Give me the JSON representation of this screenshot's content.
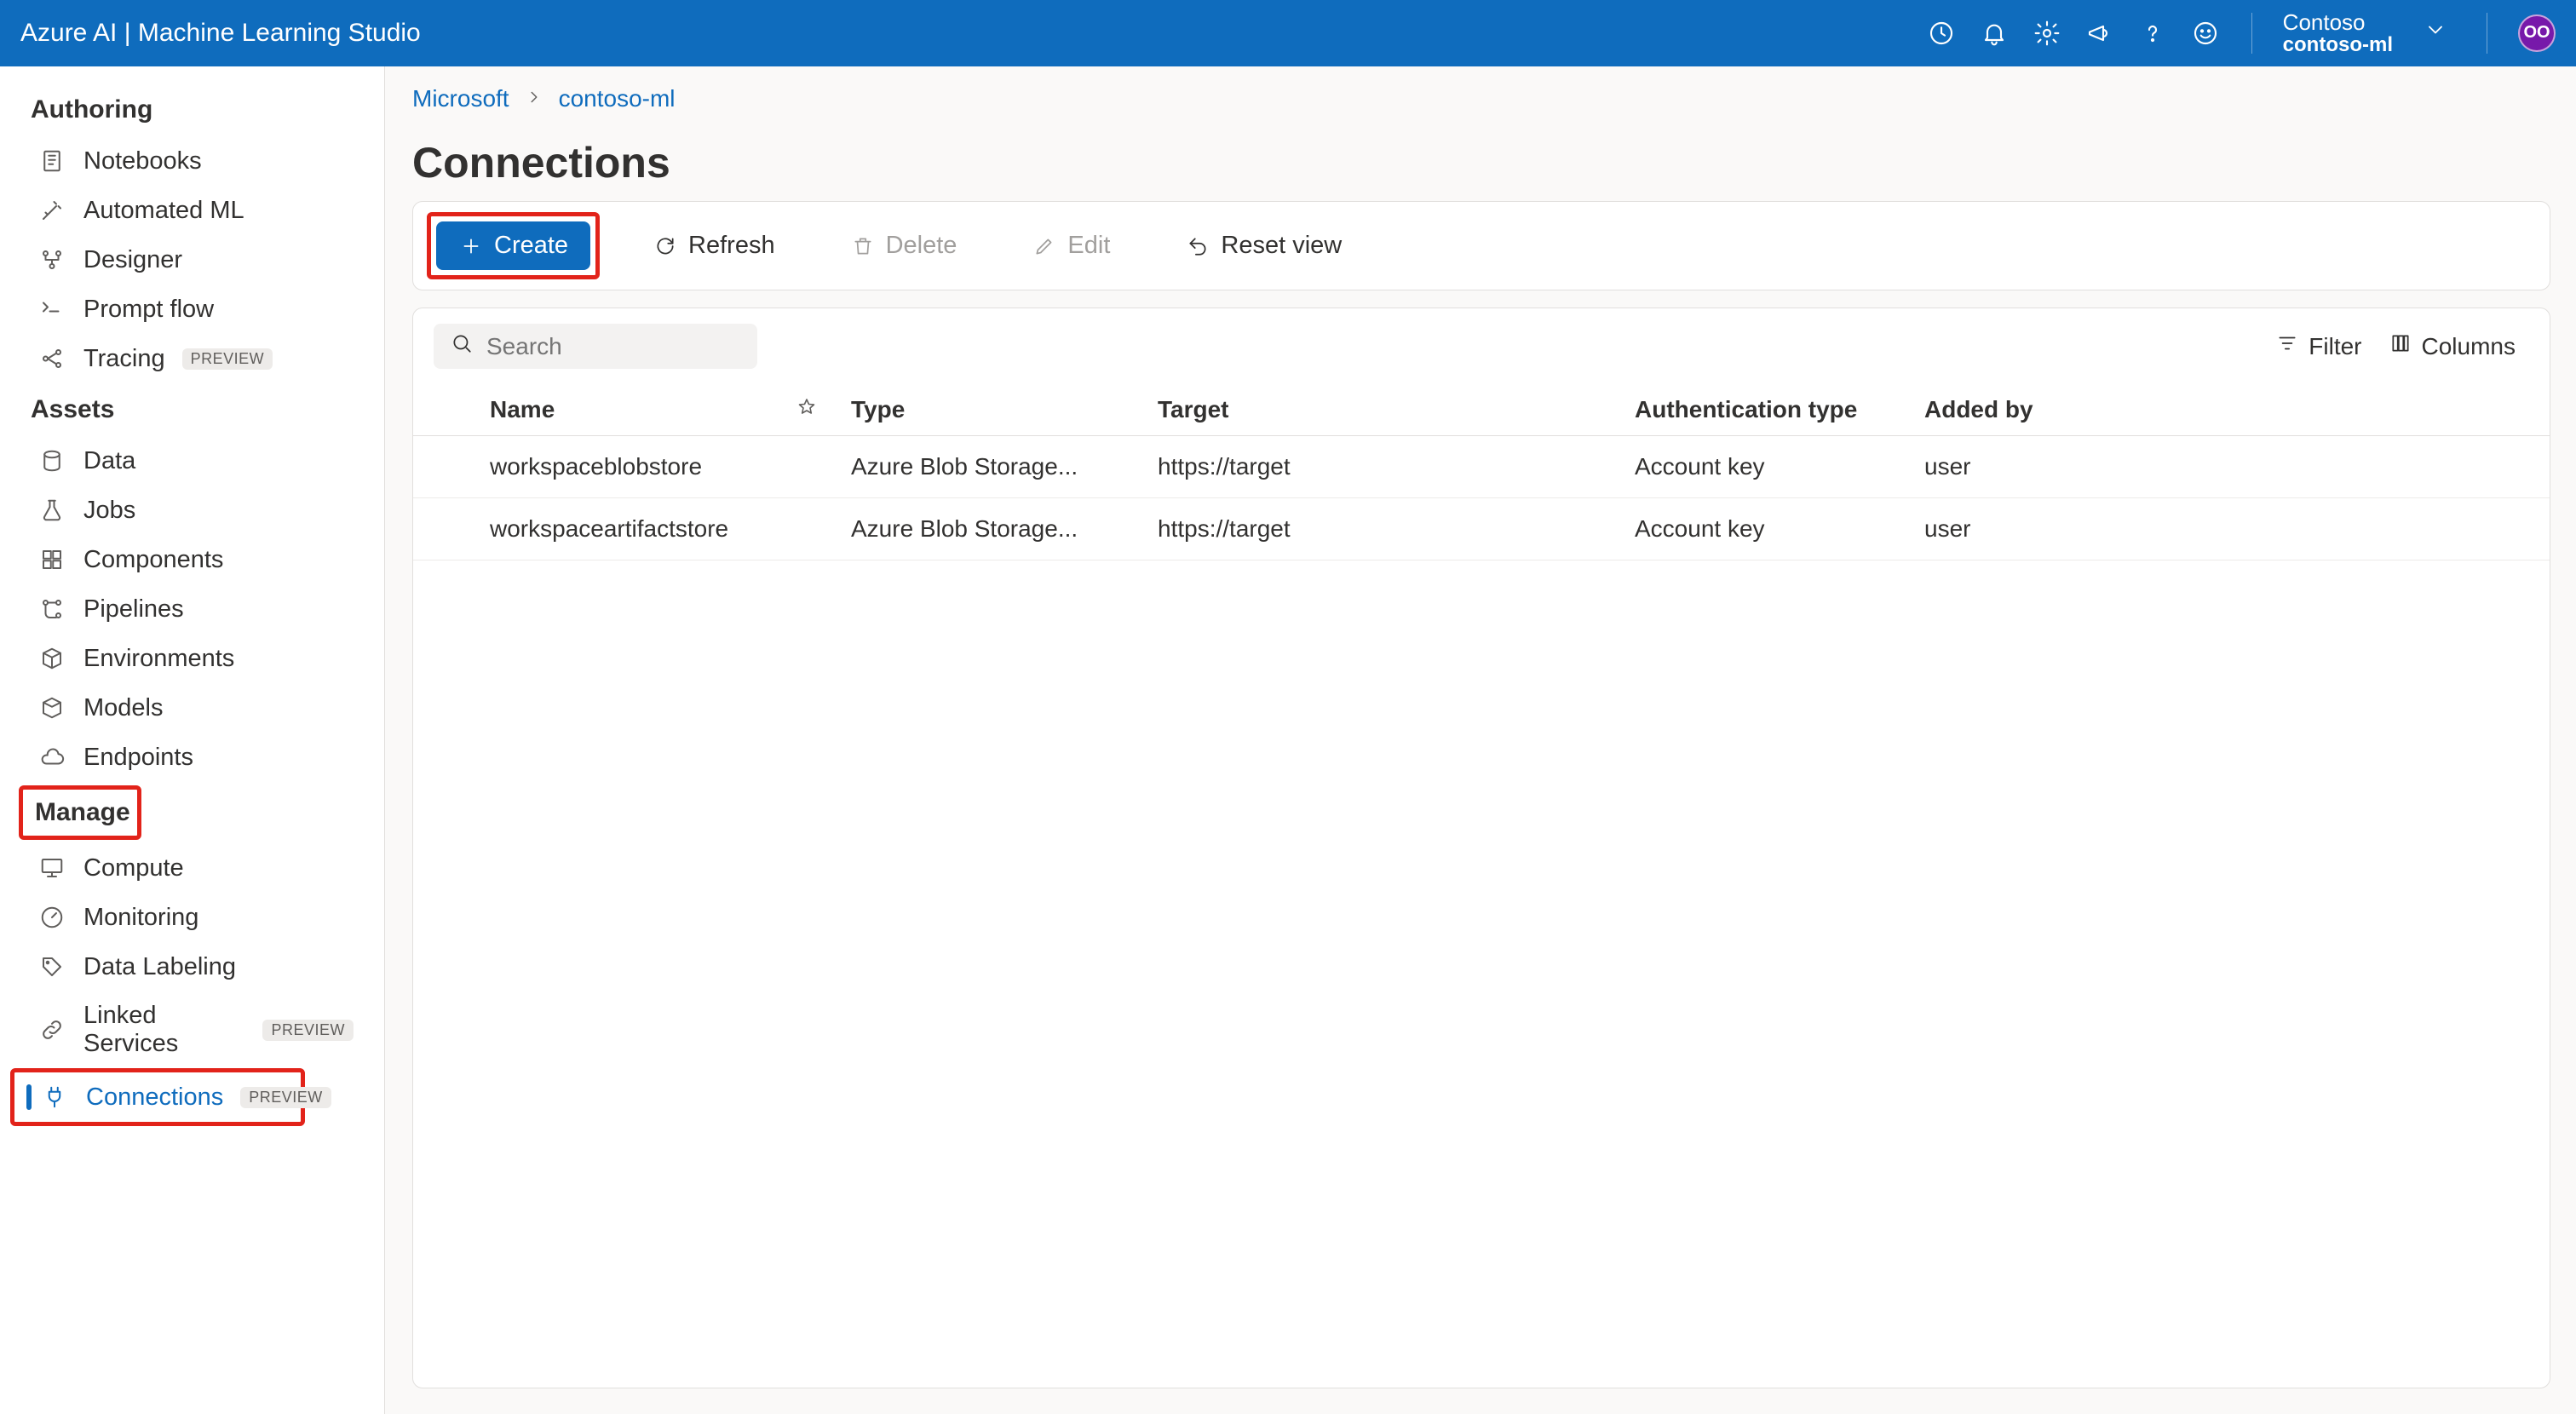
{
  "topbar": {
    "title": "Azure AI | Machine Learning Studio",
    "tenant": "Contoso",
    "workspace": "contoso-ml",
    "avatar": "OO"
  },
  "sidebar": {
    "sections": {
      "authoring": "Authoring",
      "assets": "Assets",
      "manage": "Manage"
    },
    "authoring": {
      "notebooks": "Notebooks",
      "automl": "Automated ML",
      "designer": "Designer",
      "promptflow": "Prompt flow",
      "tracing": "Tracing",
      "tracing_badge": "PREVIEW"
    },
    "assets": {
      "data": "Data",
      "jobs": "Jobs",
      "components": "Components",
      "pipelines": "Pipelines",
      "environments": "Environments",
      "models": "Models",
      "endpoints": "Endpoints"
    },
    "manage": {
      "compute": "Compute",
      "monitoring": "Monitoring",
      "datalabeling": "Data Labeling",
      "linkedservices": "Linked Services",
      "linkedservices_badge": "PREVIEW",
      "connections": "Connections",
      "connections_badge": "PREVIEW"
    }
  },
  "breadcrumb": {
    "root": "Microsoft",
    "ws": "contoso-ml"
  },
  "page": {
    "title": "Connections"
  },
  "toolbar": {
    "create": "Create",
    "refresh": "Refresh",
    "delete": "Delete",
    "edit": "Edit",
    "reset": "Reset view"
  },
  "tablebar": {
    "search_placeholder": "Search",
    "filter": "Filter",
    "columns": "Columns"
  },
  "table": {
    "headers": {
      "name": "Name",
      "type": "Type",
      "target": "Target",
      "auth": "Authentication type",
      "added": "Added by"
    },
    "rows": [
      {
        "name": "workspaceblobstore",
        "type": "Azure Blob Storage...",
        "target": "https://target",
        "auth": "Account key",
        "added": "user"
      },
      {
        "name": "workspaceartifactstore",
        "type": "Azure Blob Storage...",
        "target": "https://target",
        "auth": "Account key",
        "added": "user"
      }
    ]
  }
}
